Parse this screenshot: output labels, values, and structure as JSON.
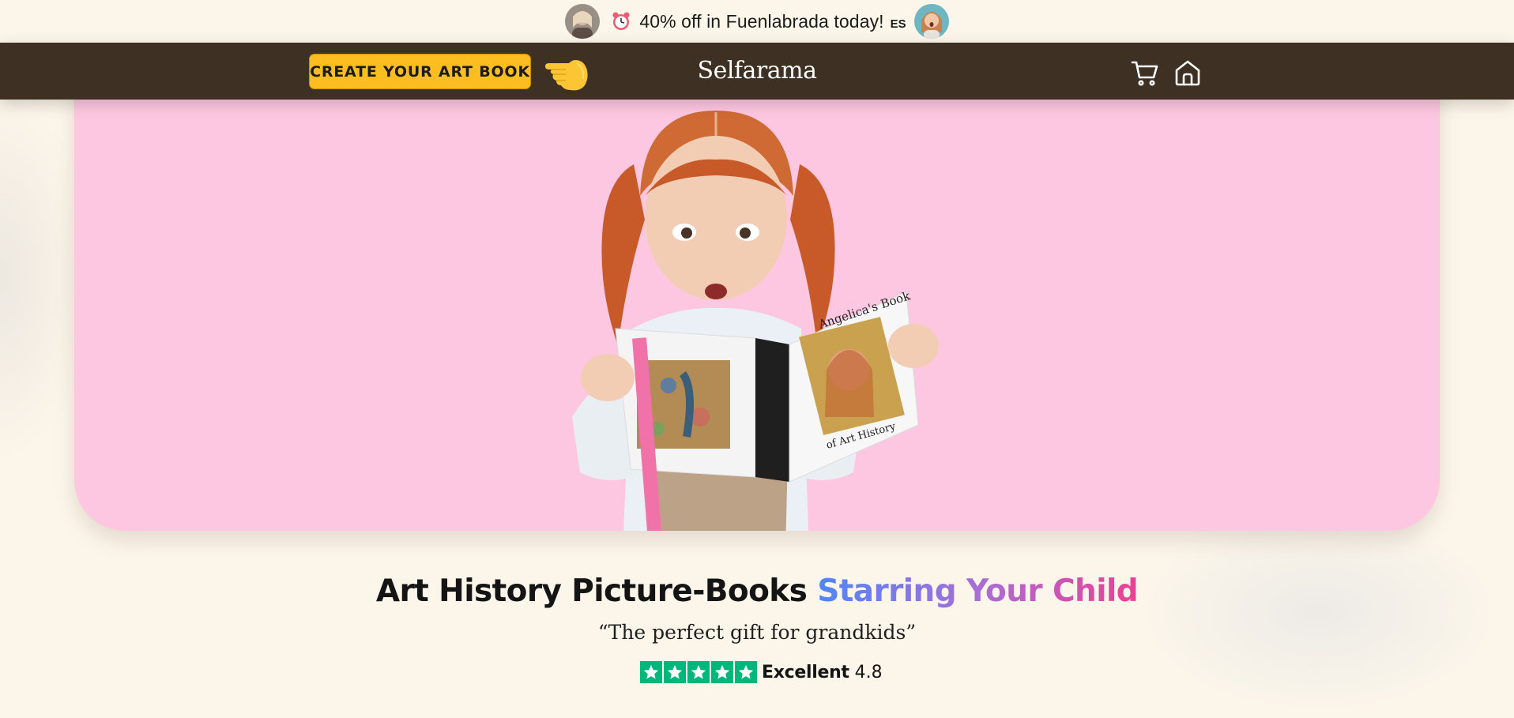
{
  "promo": {
    "text": "40% off in Fuenlabrada today!",
    "lang": "ES",
    "icons": [
      "user-avatar",
      "alarm-clock-icon",
      "user-avatar"
    ]
  },
  "header": {
    "cta_label": "CREATE YOUR ART BOOK",
    "brand": "Selfarama",
    "icons": [
      "pointing-hand-icon",
      "cart-icon",
      "home-icon"
    ]
  },
  "hero": {
    "book_title_line1": "Angelica's Book",
    "book_title_line2": "of Art History",
    "background_color": "#fec7e1"
  },
  "headline": {
    "part1": "Art History Picture-Books",
    "part2": "Starring Your Child"
  },
  "subquote": "“The perfect gift for grandkids”",
  "rating": {
    "stars": 5,
    "label": "Excellent",
    "score": "4.8",
    "color": "#00b67a"
  },
  "colors": {
    "header_bg": "#3e3124",
    "cta_bg": "#fbbd20",
    "page_bg": "#fcf6ea"
  }
}
